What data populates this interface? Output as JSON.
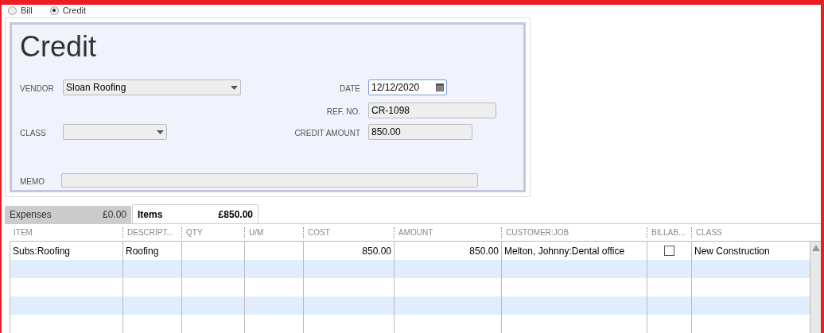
{
  "mode": [
    {
      "label": "Bill",
      "selected": false
    },
    {
      "label": "Credit",
      "selected": true
    }
  ],
  "form": {
    "title": "Credit",
    "vendor": {
      "label": "VENDOR",
      "value": "Sloan Roofing"
    },
    "date": {
      "label": "DATE",
      "value": "12/12/2020",
      "focused": true
    },
    "ref_no": {
      "label": "REF. NO.",
      "value": "CR-1098"
    },
    "class": {
      "label": "CLASS"
    },
    "credit_amount": {
      "label": "CREDIT AMOUNT",
      "value": "850.00"
    },
    "memo": {
      "label": "MEMO"
    }
  },
  "tabs": [
    {
      "label": "Expenses",
      "amount": "£0.00",
      "selected": false
    },
    {
      "label": "Items",
      "amount": "£850.00",
      "selected": true
    }
  ],
  "table": {
    "columns": [
      "ITEM",
      "DESCRIPT...",
      "QTY",
      "U/M",
      "COST",
      "AMOUNT",
      "CUSTOMER:JOB",
      "BILLAB...",
      "CLASS"
    ],
    "rows": [
      {
        "item": "Subs:Roofing",
        "description": "Roofing",
        "cost": "850.00",
        "amount": "850.00",
        "customer_job": "Melton, Johnny:Dental office",
        "billable": false,
        "class": "New Construction"
      }
    ]
  }
}
